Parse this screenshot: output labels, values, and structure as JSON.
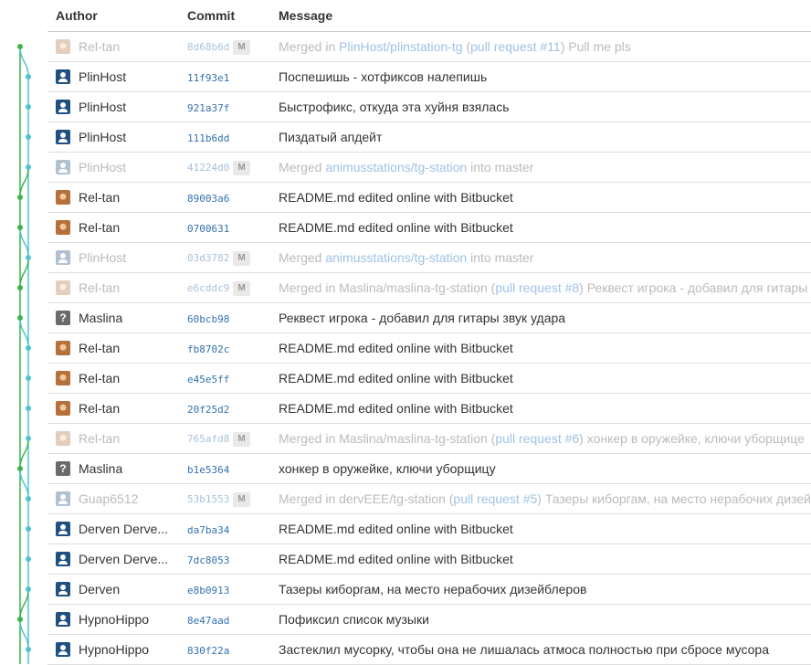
{
  "columns": {
    "author": "Author",
    "commit": "Commit",
    "message": "Message"
  },
  "merge_badge": "M",
  "colors": {
    "graph_green": "#3cb648",
    "graph_cyan": "#4fc3d3",
    "link": "#3572b0"
  },
  "commits": [
    {
      "author": "Rel-tan",
      "avatar": "photo",
      "hash": "8d68b6d",
      "merge": true,
      "lane": 0,
      "message": [
        {
          "t": "Merged in "
        },
        {
          "t": "PlinHost/plinstation-tg",
          "link": true
        },
        {
          "t": " ("
        },
        {
          "t": "pull request #11",
          "link": true
        },
        {
          "t": ") Pull me pls"
        }
      ]
    },
    {
      "author": "PlinHost",
      "avatar": "person",
      "hash": "11f93e1",
      "merge": false,
      "lane": 1,
      "message": [
        {
          "t": "Поспешишь - хотфиксов налепишь"
        }
      ]
    },
    {
      "author": "PlinHost",
      "avatar": "person",
      "hash": "921a37f",
      "merge": false,
      "lane": 1,
      "message": [
        {
          "t": "Быстрофикс, откуда эта хуйня взялась"
        }
      ]
    },
    {
      "author": "PlinHost",
      "avatar": "person",
      "hash": "111b6dd",
      "merge": false,
      "lane": 1,
      "message": [
        {
          "t": "Пиздатый апдейт"
        }
      ]
    },
    {
      "author": "PlinHost",
      "avatar": "person",
      "hash": "41224d0",
      "merge": true,
      "lane": 1,
      "message": [
        {
          "t": "Merged "
        },
        {
          "t": "animusstations/tg-station",
          "link": true
        },
        {
          "t": " into master"
        }
      ]
    },
    {
      "author": "Rel-tan",
      "avatar": "photo",
      "hash": "89003a6",
      "merge": false,
      "lane": 0,
      "message": [
        {
          "t": "README.md edited online with Bitbucket"
        }
      ]
    },
    {
      "author": "Rel-tan",
      "avatar": "photo",
      "hash": "0700631",
      "merge": false,
      "lane": 0,
      "message": [
        {
          "t": "README.md edited online with Bitbucket"
        }
      ]
    },
    {
      "author": "PlinHost",
      "avatar": "person",
      "hash": "03d3782",
      "merge": true,
      "lane": 1,
      "message": [
        {
          "t": "Merged "
        },
        {
          "t": "animusstations/tg-station",
          "link": true
        },
        {
          "t": " into master"
        }
      ]
    },
    {
      "author": "Rel-tan",
      "avatar": "photo",
      "hash": "e6cddc9",
      "merge": true,
      "lane": 0,
      "message": [
        {
          "t": "Merged in Maslina/maslina-tg-station ("
        },
        {
          "t": "pull request #8",
          "link": true
        },
        {
          "t": ") Реквест игрока - добавил для гитары звук удара"
        }
      ]
    },
    {
      "author": "Maslina",
      "avatar": "unknown",
      "hash": "60bcb98",
      "merge": false,
      "lane": 0,
      "message": [
        {
          "t": "Реквест игрока - добавил для гитары звук удара"
        }
      ]
    },
    {
      "author": "Rel-tan",
      "avatar": "photo",
      "hash": "fb8702c",
      "merge": false,
      "lane": 1,
      "message": [
        {
          "t": "README.md edited online with Bitbucket"
        }
      ]
    },
    {
      "author": "Rel-tan",
      "avatar": "photo",
      "hash": "e45e5ff",
      "merge": false,
      "lane": 1,
      "message": [
        {
          "t": "README.md edited online with Bitbucket"
        }
      ]
    },
    {
      "author": "Rel-tan",
      "avatar": "photo",
      "hash": "20f25d2",
      "merge": false,
      "lane": 1,
      "message": [
        {
          "t": "README.md edited online with Bitbucket"
        }
      ]
    },
    {
      "author": "Rel-tan",
      "avatar": "photo",
      "hash": "765afd8",
      "merge": true,
      "lane": 1,
      "message": [
        {
          "t": "Merged in Maslina/maslina-tg-station ("
        },
        {
          "t": "pull request #6",
          "link": true
        },
        {
          "t": ") хонкер в оружейке, ключи уборщице"
        }
      ]
    },
    {
      "author": "Maslina",
      "avatar": "unknown",
      "hash": "b1e5364",
      "merge": false,
      "lane": 0,
      "message": [
        {
          "t": "хонкер в оружейке, ключи уборщицу"
        }
      ]
    },
    {
      "author": "Guap6512",
      "avatar": "person",
      "hash": "53b1553",
      "merge": true,
      "lane": 1,
      "message": [
        {
          "t": "Merged in dervEEE/tg-station ("
        },
        {
          "t": "pull request #5",
          "link": true
        },
        {
          "t": ") Тазеры киборгам, на место нерабочих дизейблеров"
        }
      ]
    },
    {
      "author": "Derven Derve...",
      "avatar": "person",
      "hash": "da7ba34",
      "merge": false,
      "lane": 1,
      "message": [
        {
          "t": "README.md edited online with Bitbucket"
        }
      ]
    },
    {
      "author": "Derven Derve...",
      "avatar": "person",
      "hash": "7dc8053",
      "merge": false,
      "lane": 1,
      "message": [
        {
          "t": "README.md edited online with Bitbucket"
        }
      ]
    },
    {
      "author": "Derven",
      "avatar": "person",
      "hash": "e8b0913",
      "merge": false,
      "lane": 1,
      "message": [
        {
          "t": "Тазеры киборгам, на место нерабочих дизейблеров"
        }
      ]
    },
    {
      "author": "HypnoHippo",
      "avatar": "person",
      "hash": "8e47aad",
      "merge": false,
      "lane": 0,
      "message": [
        {
          "t": "Пофиксил список музыки"
        }
      ]
    },
    {
      "author": "HypnoHippo",
      "avatar": "person",
      "hash": "830f22a",
      "merge": false,
      "lane": 1,
      "message": [
        {
          "t": "Застеклил мусорку, чтобы она не лишалась атмоса полностью при сбросе мусора"
        }
      ]
    }
  ]
}
